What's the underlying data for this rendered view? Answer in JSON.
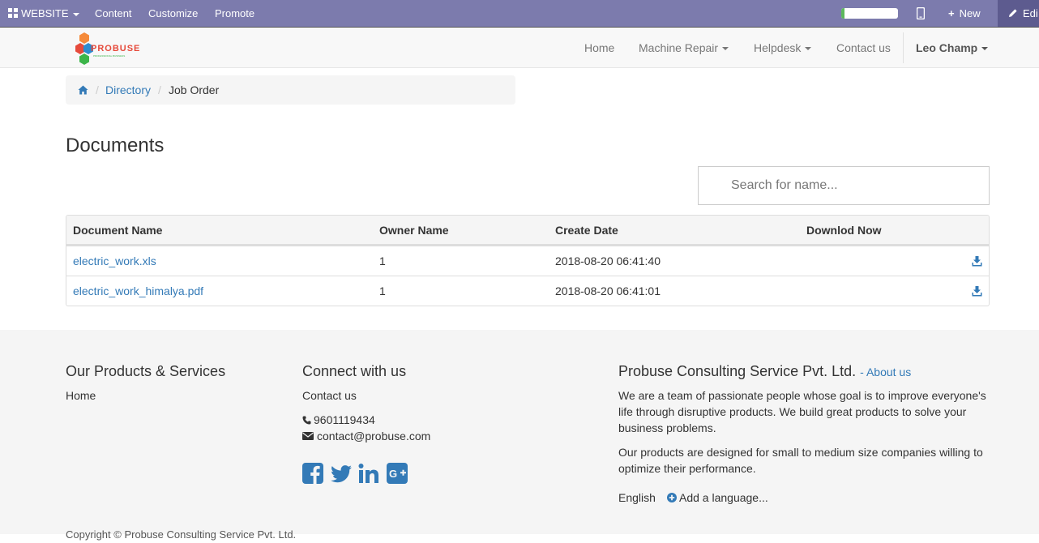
{
  "admin_bar": {
    "website_label": "WEBSITE",
    "menu": [
      "Content",
      "Customize",
      "Promote"
    ],
    "new_label": "New",
    "edit_label": "Edi",
    "progress_fraction": 0.05
  },
  "brand": {
    "name": "PROBUSE",
    "tagline": "PROFESSIONAL BUSINESS"
  },
  "nav": {
    "items": [
      {
        "label": "Home"
      },
      {
        "label": "Machine Repair"
      },
      {
        "label": "Helpdesk"
      },
      {
        "label": "Contact us"
      }
    ],
    "user": "Leo Champ"
  },
  "breadcrumb": {
    "items": [
      "Directory",
      "Job Order"
    ]
  },
  "page": {
    "title": "Documents",
    "search_placeholder": "Search for name..."
  },
  "table": {
    "headers": [
      "Document Name",
      "Owner Name",
      "Create Date",
      "Downlod Now"
    ],
    "rows": [
      {
        "name": "electric_work.xls",
        "owner": "1",
        "date": "2018-08-20 06:41:40"
      },
      {
        "name": "electric_work_himalya.pdf",
        "owner": "1",
        "date": "2018-08-20 06:41:01"
      }
    ]
  },
  "footer": {
    "products_title": "Our Products & Services",
    "products_link": "Home",
    "connect_title": "Connect with us",
    "connect_link": "Contact us",
    "phone": "9601119434",
    "email": "contact@probuse.com",
    "company_title": "Probuse Consulting Service Pvt. Ltd.",
    "about_link": "- About us",
    "about_p1": "We are a team of passionate people whose goal is to improve everyone's life through disruptive products. We build great products to solve your business problems.",
    "about_p2": "Our products are designed for small to medium size companies willing to optimize their performance.",
    "language": "English",
    "add_language": "Add a language...",
    "copyright": "Copyright © Probuse Consulting Service Pvt. Ltd."
  },
  "colors": {
    "admin_bar": "#7c7bad",
    "link": "#337ab7",
    "social": "#337ab7"
  }
}
